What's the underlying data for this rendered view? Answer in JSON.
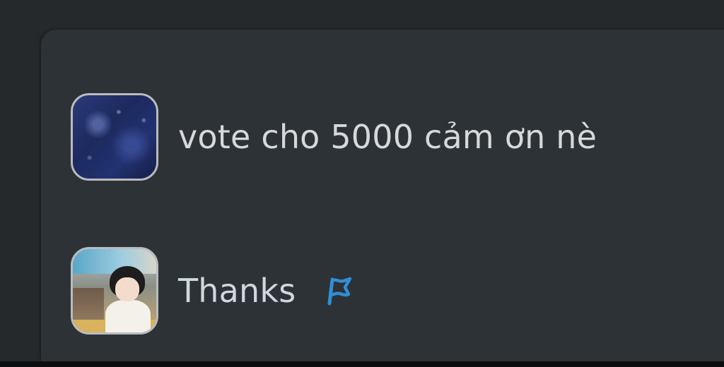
{
  "comments": [
    {
      "avatar_icon": "galaxy-avatar-icon",
      "text": "vote cho 5000 cảm ơn nè"
    },
    {
      "avatar_icon": "anime-avatar-icon",
      "text": "Thanks",
      "action_icon": "flag-icon"
    }
  ],
  "colors": {
    "background": "#25292b",
    "panel": "#2d3236",
    "text": "#d7d8d9",
    "flag": "#2f8fd6"
  }
}
